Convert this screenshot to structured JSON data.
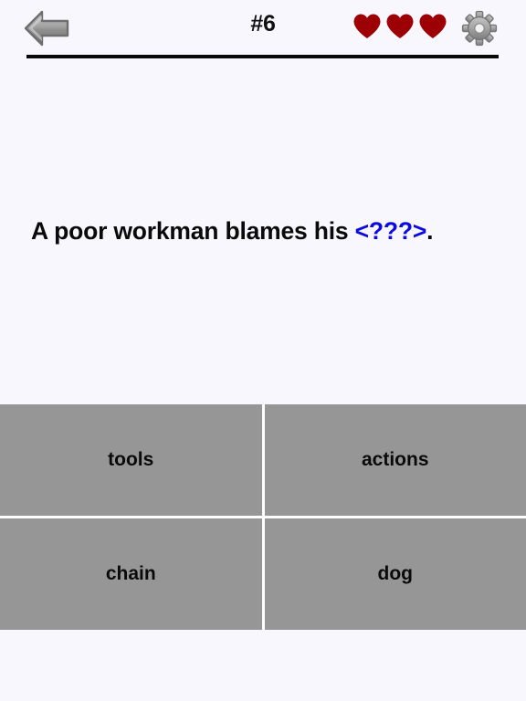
{
  "header": {
    "back_icon": "back-arrow-icon",
    "level_label": "#6",
    "lives_count": 3,
    "lives_icon": "heart-icon",
    "heart_color": "#9c0005",
    "settings_icon": "gear-icon",
    "gear_color": "#9a9a9a"
  },
  "question": {
    "prefix": "A poor workman blames his ",
    "blank": "<???>",
    "suffix": ".",
    "blank_color": "#0b0be0",
    "text_color": "#0a0a0a"
  },
  "answers": {
    "background_color": "#969696",
    "options": [
      {
        "label": "tools"
      },
      {
        "label": "actions"
      },
      {
        "label": "chain"
      },
      {
        "label": "dog"
      }
    ]
  },
  "page": {
    "background_color": "#f8f7fd"
  }
}
